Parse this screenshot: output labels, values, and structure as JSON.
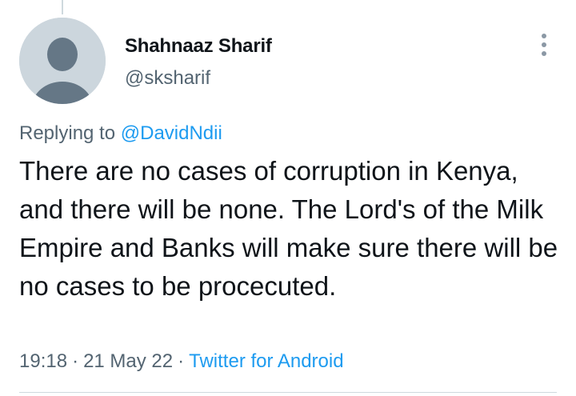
{
  "author": {
    "display_name": "Shahnaaz Sharif",
    "handle": "@sksharif",
    "avatar_icon": "default-avatar-icon"
  },
  "reply": {
    "prefix": "Replying to",
    "mention": "@DavidNdii"
  },
  "tweet": {
    "text": "There are no cases of corruption in Kenya, and there will be none. The Lord's of the Milk Empire and Banks will make sure there will be no cases to be procecuted."
  },
  "meta": {
    "time": "19:18",
    "separator": "·",
    "date": "21 May 22",
    "source": "Twitter for Android"
  },
  "menu": {
    "icon": "more-options-icon"
  },
  "colors": {
    "text": "#0f1419",
    "secondary": "#536471",
    "link": "#1d9bf0",
    "avatar_bg": "#ccd6dd",
    "avatar_fg": "#657786"
  }
}
